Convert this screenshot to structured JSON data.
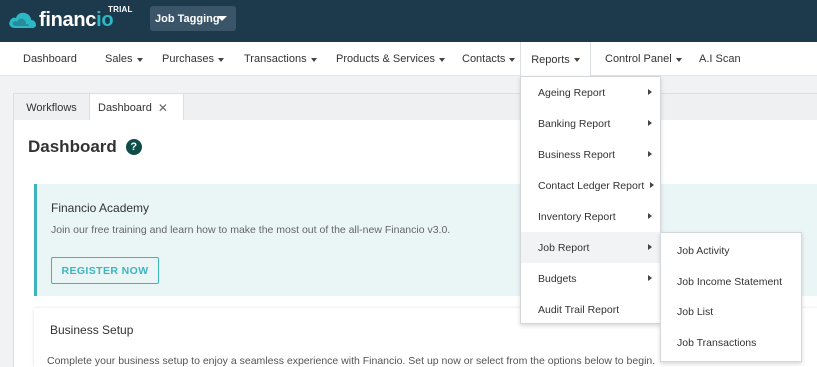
{
  "brand": {
    "logo_text_main": "financ",
    "logo_text_accent": "io",
    "trial_badge": "TRIAL",
    "org_selector": "Job Tagging",
    "accent_color": "#2bb7c4",
    "topbar_color": "#1d3a4c"
  },
  "nav": {
    "items": [
      {
        "label": "Dashboard"
      },
      {
        "label": "Sales"
      },
      {
        "label": "Purchases"
      },
      {
        "label": "Transactions"
      },
      {
        "label": "Products & Services"
      },
      {
        "label": "Contacts"
      },
      {
        "label": "Reports"
      },
      {
        "label": "Control Panel"
      },
      {
        "label": "A.I Scan"
      }
    ]
  },
  "tabs": [
    {
      "label": "Workflows"
    },
    {
      "label": "Dashboard",
      "close_icon": "close-icon",
      "close_glyph": "✕"
    }
  ],
  "main": {
    "title": "Dashboard",
    "help_glyph": "?",
    "academy": {
      "title": "Financio Academy",
      "text": "Join our free training and learn how to make the most out of the all-new Financio v3.0.",
      "button": "REGISTER NOW"
    },
    "setup": {
      "title": "Business Setup",
      "text": "Complete your business setup to enjoy a seamless experience with Financio. Set up now or select from the options below to begin."
    }
  },
  "reports_menu": {
    "items": [
      {
        "label": "Ageing Report"
      },
      {
        "label": "Banking Report"
      },
      {
        "label": "Business Report"
      },
      {
        "label": "Contact Ledger Report"
      },
      {
        "label": "Inventory Report"
      },
      {
        "label": "Job Report"
      },
      {
        "label": "Budgets"
      },
      {
        "label": "Audit Trail Report"
      }
    ],
    "submenu": [
      {
        "label": "Job Activity"
      },
      {
        "label": "Job Income Statement"
      },
      {
        "label": "Job List"
      },
      {
        "label": "Job Transactions"
      }
    ]
  }
}
